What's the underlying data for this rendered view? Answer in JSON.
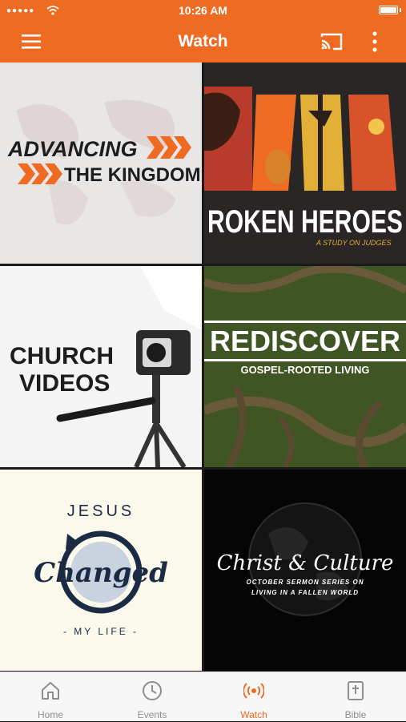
{
  "status": {
    "signal": "●●●●●",
    "time": "10:26 AM"
  },
  "header": {
    "title": "Watch"
  },
  "videos": [
    {
      "line1": "ADVANCING",
      "line2": "THE KINGDOM"
    },
    {
      "title": "ROKEN HEROES",
      "subtitle": "A STUDY ON JUDGES"
    },
    {
      "line1": "CHURCH",
      "line2": "VIDEOS"
    },
    {
      "title": "REDISCOVER",
      "subtitle": "GOSPEL-ROOTED LIVING"
    },
    {
      "top": "JESUS",
      "script": "Changed",
      "bottom": "- MY LIFE -"
    },
    {
      "title": "Christ & Culture",
      "subtitle1": "OCTOBER SERMON SERIES ON",
      "subtitle2": "LIVING IN A FALLEN WORLD"
    }
  ],
  "tabs": [
    {
      "label": "Home",
      "icon": "home-icon"
    },
    {
      "label": "Events",
      "icon": "clock-icon"
    },
    {
      "label": "Watch",
      "icon": "broadcast-icon",
      "active": true
    },
    {
      "label": "Bible",
      "icon": "bible-icon"
    }
  ],
  "colors": {
    "accent": "#ef6b22"
  }
}
